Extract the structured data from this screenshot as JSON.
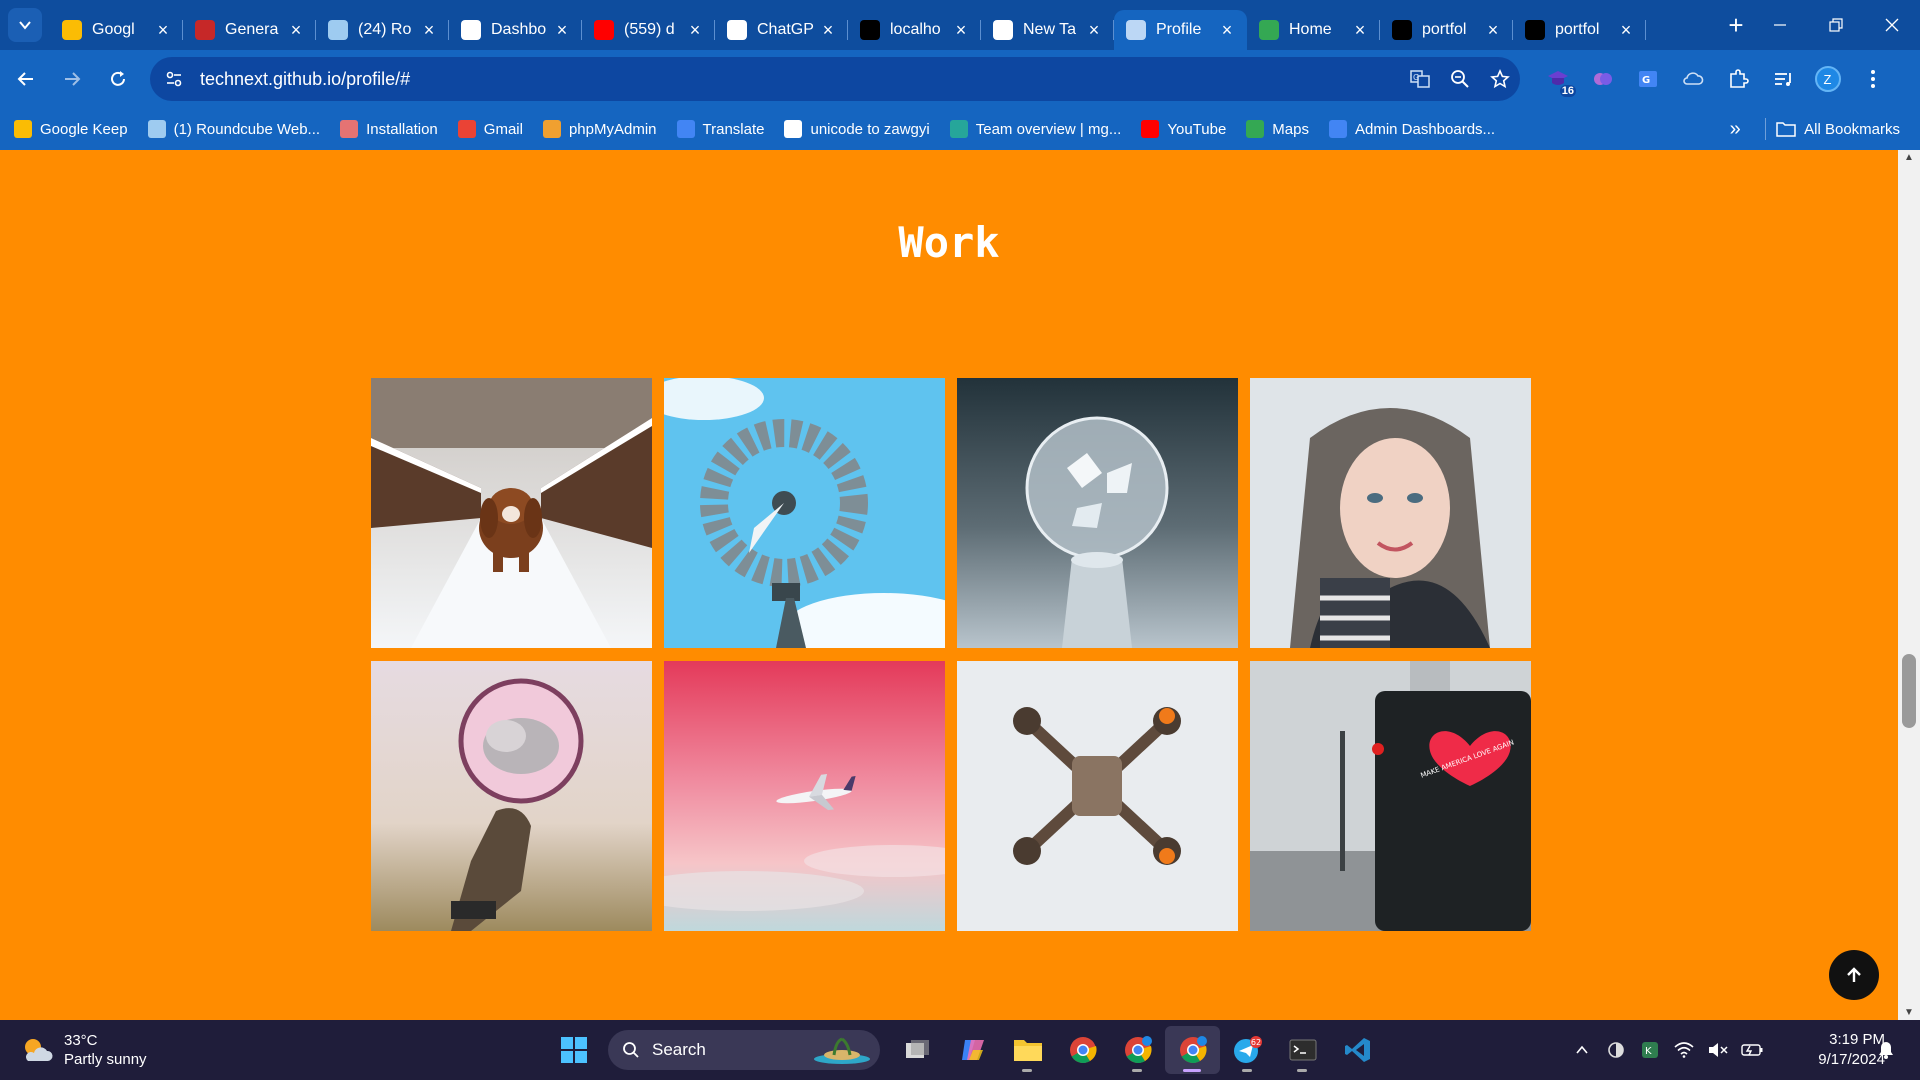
{
  "browser": {
    "tabs": [
      {
        "title": "Googl",
        "favicon": "google-keep-icon",
        "color": "#fbbc04",
        "active": false
      },
      {
        "title": "Genera",
        "favicon": "generator-icon",
        "color": "#c62828",
        "active": false
      },
      {
        "title": "(24) Ro",
        "favicon": "roundcube-icon",
        "color": "#9ecbf0",
        "active": false
      },
      {
        "title": "Dashbo",
        "favicon": "wordpress-icon",
        "color": "#ffffff",
        "active": false
      },
      {
        "title": "(559) d",
        "favicon": "youtube-icon",
        "color": "#ff0000",
        "active": false
      },
      {
        "title": "ChatGP",
        "favicon": "chatgpt-icon",
        "color": "#ffffff",
        "active": false
      },
      {
        "title": "localho",
        "favicon": "vercel-icon",
        "color": "#000000",
        "active": false
      },
      {
        "title": "New Ta",
        "favicon": "chrome-icon",
        "color": "#ffffff",
        "active": false
      },
      {
        "title": "Profile",
        "favicon": "globe-icon",
        "color": "#bcd7f5",
        "active": true
      },
      {
        "title": "Home",
        "favicon": "google-drive-icon",
        "color": "#34a853",
        "active": false
      },
      {
        "title": "portfol",
        "favicon": "vercel-icon",
        "color": "#000000",
        "active": false
      },
      {
        "title": "portfol",
        "favicon": "vercel-icon",
        "color": "#000000",
        "active": false
      }
    ],
    "url": "technext.github.io/profile/#",
    "extension_badge": "16",
    "profile_initial": "Z",
    "bookmarks": [
      {
        "label": "Google Keep",
        "icon": "google-keep-icon",
        "color": "#fbbc04"
      },
      {
        "label": "(1) Roundcube Web...",
        "icon": "roundcube-icon",
        "color": "#9ecbf0"
      },
      {
        "label": "Installation",
        "icon": "installation-icon",
        "color": "#e57373"
      },
      {
        "label": "Gmail",
        "icon": "gmail-icon",
        "color": "#ea4335"
      },
      {
        "label": "phpMyAdmin",
        "icon": "phpmyadmin-icon",
        "color": "#f0a030"
      },
      {
        "label": "Translate",
        "icon": "translate-icon",
        "color": "#4285f4"
      },
      {
        "label": "unicode to zawgyi",
        "icon": "globe-icon",
        "color": "#ffffff"
      },
      {
        "label": "Team overview | mg...",
        "icon": "team-icon",
        "color": "#26a69a"
      },
      {
        "label": "YouTube",
        "icon": "youtube-icon",
        "color": "#ff0000"
      },
      {
        "label": "Maps",
        "icon": "maps-icon",
        "color": "#34a853"
      },
      {
        "label": "Admin Dashboards...",
        "icon": "admin-icon",
        "color": "#4285f4"
      }
    ],
    "all_bookmarks_label": "All Bookmarks"
  },
  "page": {
    "section_title": "Work",
    "background": "#ff8c00",
    "gallery": [
      {
        "name": "puppy-in-snow"
      },
      {
        "name": "windmill-sky"
      },
      {
        "name": "crystal-ball"
      },
      {
        "name": "woman-portrait"
      },
      {
        "name": "hand-mirror-clouds"
      },
      {
        "name": "airplane-pink-sky"
      },
      {
        "name": "drone-top-view"
      },
      {
        "name": "heart-sticker-post",
        "text": "MAKE AMERICA LOVE AGAIN"
      }
    ]
  },
  "taskbar": {
    "weather_temp": "33°C",
    "weather_desc": "Partly sunny",
    "search_label": "Search",
    "time": "3:19 PM",
    "date": "9/17/2024",
    "telegram_badge": "62"
  }
}
